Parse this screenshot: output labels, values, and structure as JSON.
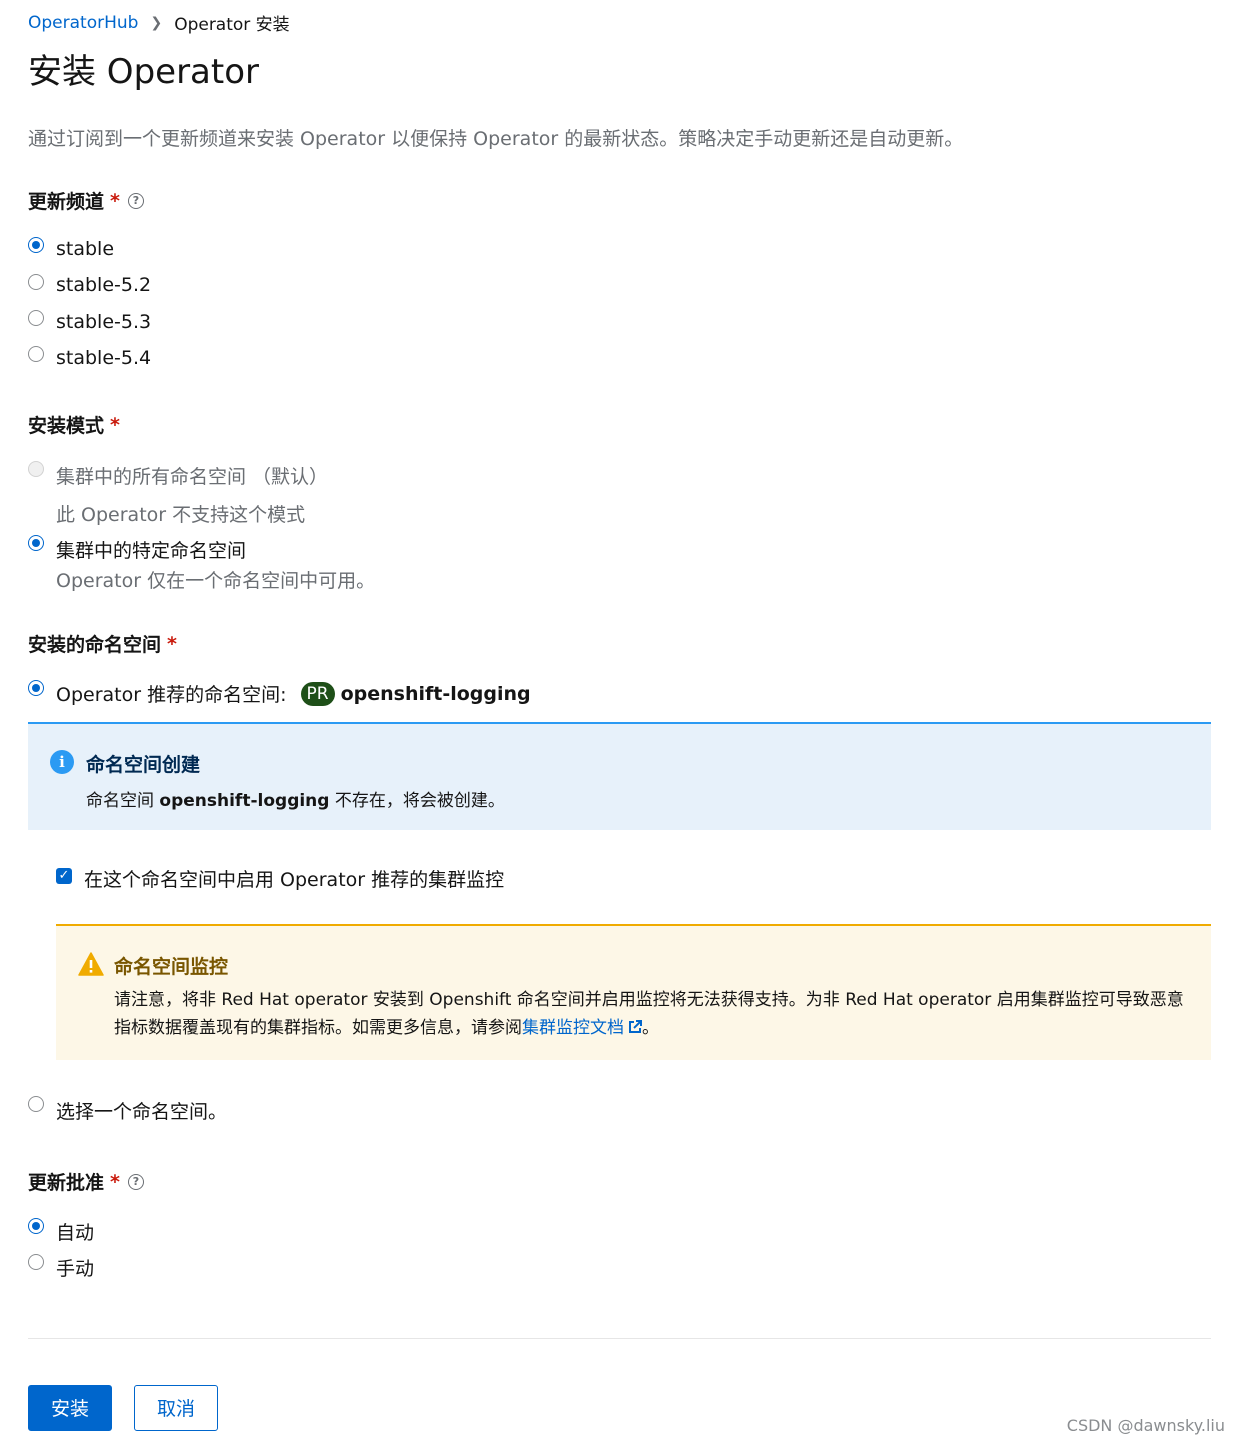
{
  "breadcrumb": {
    "parent": "OperatorHub",
    "current": "Operator 安装"
  },
  "page_title": "安装 Operator",
  "description": "通过订阅到一个更新频道来安装 Operator 以便保持 Operator 的最新状态。策略决定手动更新还是自动更新。",
  "update_channel": {
    "label": "更新频道",
    "required_mark": "*",
    "options": [
      "stable",
      "stable-5.2",
      "stable-5.3",
      "stable-5.4"
    ],
    "selected": "stable"
  },
  "install_mode": {
    "label": "安装模式",
    "required_mark": "*",
    "all_namespaces": {
      "label": "集群中的所有命名空间 （默认）",
      "note": "此 Operator 不支持这个模式"
    },
    "specific_namespace": {
      "label": "集群中的特定命名空间",
      "note": "Operator 仅在一个命名空间中可用。"
    }
  },
  "installed_namespace": {
    "label": "安装的命名空间",
    "required_mark": "*",
    "recommended_label": "Operator 推荐的命名空间:",
    "badge": "PR",
    "namespace": "openshift-logging",
    "info_alert": {
      "title": "命名空间创建",
      "body_prefix": "命名空间",
      "body_namespace": "openshift-logging",
      "body_suffix": "不存在，将会被创建。"
    },
    "monitoring_checkbox_label": "在这个命名空间中启用 Operator 推荐的集群监控",
    "warning_alert": {
      "title": "命名空间监控",
      "body": "请注意，将非 Red Hat operator 安装到 Openshift 命名空间并启用监控将无法获得支持。为非 Red Hat operator 启用集群监控可导致恶意指标数据覆盖现有的集群指标。如需更多信息，请参阅",
      "link_text": "集群监控文档",
      "body_end": "。"
    },
    "select_namespace_label": "选择一个命名空间。"
  },
  "update_approval": {
    "label": "更新批准",
    "required_mark": "*",
    "options": [
      "自动",
      "手动"
    ],
    "selected": "自动"
  },
  "buttons": {
    "install": "安装",
    "cancel": "取消"
  },
  "watermark": "CSDN @dawnsky.liu",
  "colors": {
    "primary": "#0066cc",
    "info": "#2b9af3",
    "warning": "#f0ab00",
    "required": "#c9190b",
    "badge": "#1e4f18"
  }
}
